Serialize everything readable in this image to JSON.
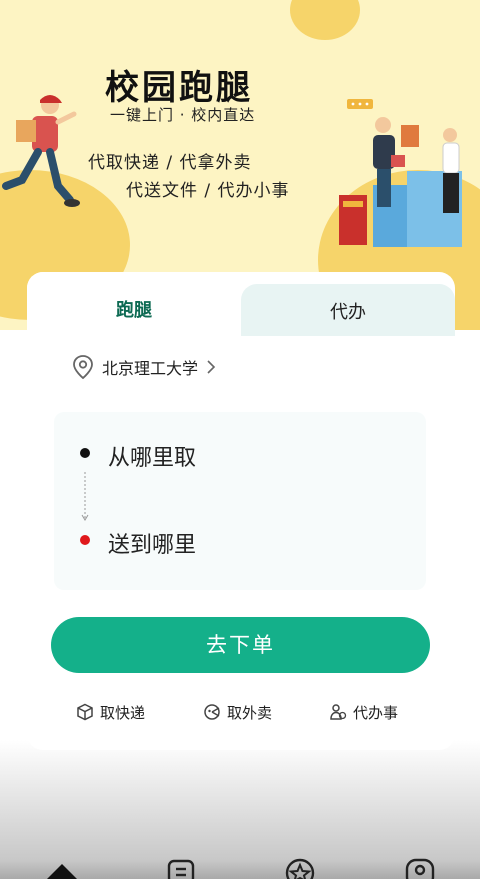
{
  "banner": {
    "title": "校园跑腿",
    "subtitle": "一键上门 · 校内直达",
    "service_line_1": "代取快递 / 代拿外卖",
    "service_line_2": "代送文件 / 代办小事"
  },
  "tabs": [
    {
      "label": "跑腿",
      "active": true
    },
    {
      "label": "代办",
      "active": false
    }
  ],
  "location": {
    "label": "北京理工大学"
  },
  "address": {
    "pickup": "从哪里取",
    "dropoff": "送到哪里"
  },
  "submit_label": "去下单",
  "quick_actions": [
    {
      "label": "取快递",
      "icon": "package-icon"
    },
    {
      "label": "取外卖",
      "icon": "takeout-icon"
    },
    {
      "label": "代办事",
      "icon": "helper-icon"
    }
  ],
  "colors": {
    "accent": "#14b08a",
    "tab_active": "#0d6a53",
    "banner_bg": "#fdf4c3",
    "dropoff_dot": "#e0181b"
  }
}
